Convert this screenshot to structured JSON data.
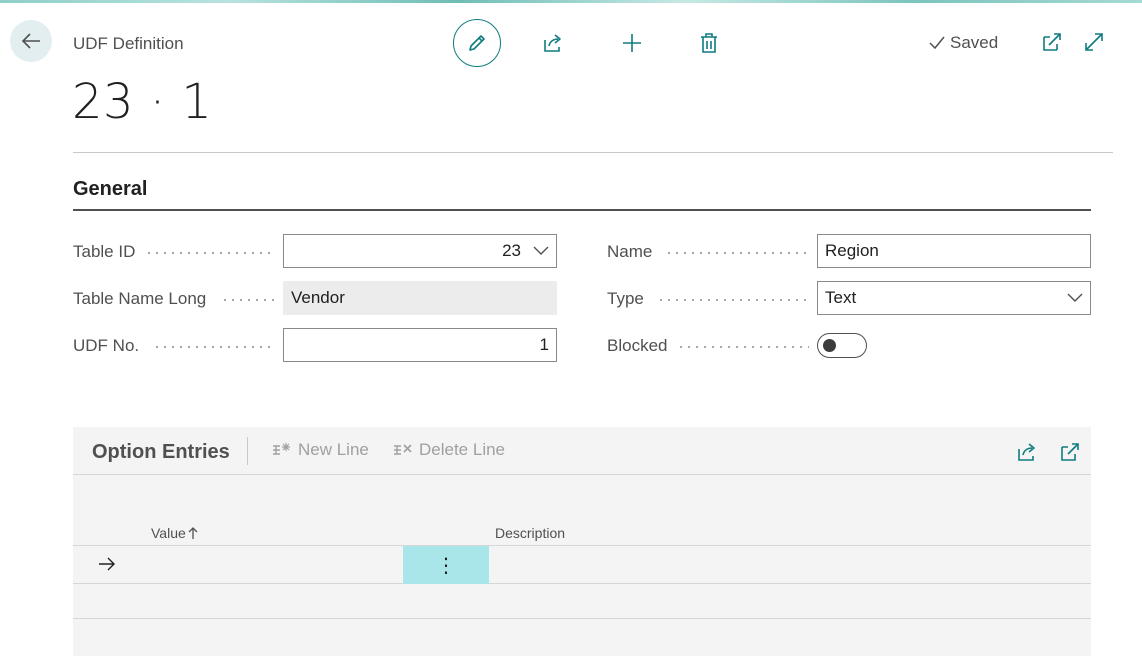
{
  "header": {
    "page_caption": "UDF Definition",
    "record_title": "23 · 1",
    "status": "Saved"
  },
  "general": {
    "section_title": "General",
    "fields": {
      "table_id": {
        "label": "Table ID",
        "value": "23"
      },
      "table_name_long": {
        "label": "Table Name Long",
        "value": "Vendor"
      },
      "udf_no": {
        "label": "UDF No.",
        "value": "1"
      },
      "name": {
        "label": "Name",
        "value": "Region"
      },
      "type": {
        "label": "Type",
        "value": "Text"
      },
      "blocked": {
        "label": "Blocked",
        "value": false
      }
    }
  },
  "option_entries": {
    "title": "Option Entries",
    "actions": {
      "new_line": "New Line",
      "delete_line": "Delete Line"
    },
    "columns": {
      "value": "Value",
      "description": "Description"
    },
    "row_menu": "⋮"
  },
  "colors": {
    "accent": "#0f7c80",
    "selected_cell": "#a9e6ea",
    "back_button_bg": "#e3eef0"
  },
  "icons": [
    "back-arrow-icon",
    "pencil-icon",
    "share-icon",
    "plus-icon",
    "trash-icon",
    "checkmark-icon",
    "open-new-window-icon",
    "expand-icon",
    "chevron-down-icon",
    "new-line-icon",
    "delete-line-icon",
    "sort-ascending-icon",
    "row-arrow-icon"
  ]
}
